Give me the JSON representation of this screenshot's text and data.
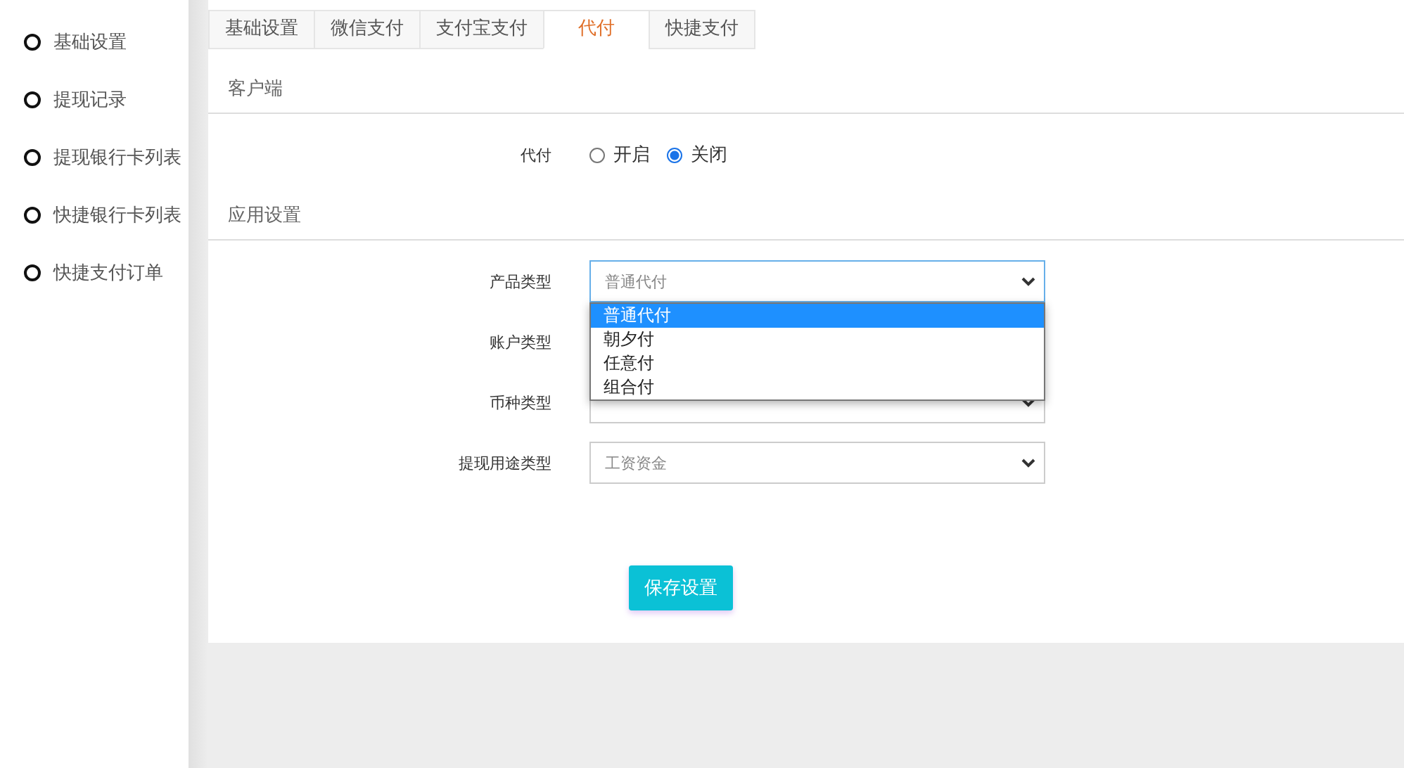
{
  "sidebar": {
    "items": [
      {
        "label": "基础设置"
      },
      {
        "label": "提现记录"
      },
      {
        "label": "提现银行卡列表"
      },
      {
        "label": "快捷银行卡列表"
      },
      {
        "label": "快捷支付订单"
      }
    ]
  },
  "tabs": [
    {
      "label": "基础设置",
      "selected": false
    },
    {
      "label": "微信支付",
      "selected": false
    },
    {
      "label": "支付宝支付",
      "selected": false
    },
    {
      "label": "代付",
      "selected": true
    },
    {
      "label": "快捷支付",
      "selected": false
    }
  ],
  "sections": [
    {
      "title": "客户端",
      "fields": [
        {
          "kind": "radio",
          "label": "代付",
          "options": [
            {
              "label": "开启",
              "selected": false
            },
            {
              "label": "关闭",
              "selected": true
            }
          ]
        }
      ]
    },
    {
      "title": "应用设置",
      "fields": [
        {
          "kind": "select",
          "label": "产品类型",
          "value": "普通代付",
          "focused": true
        },
        {
          "kind": "covered",
          "label": "账户类型"
        },
        {
          "kind": "select",
          "label": "币种类型"
        },
        {
          "kind": "select",
          "label": "提现用途类型",
          "value": "工资资金"
        }
      ]
    }
  ],
  "dropdown": {
    "options": [
      {
        "label": "普通代付",
        "selected": true
      },
      {
        "label": "朝夕付",
        "selected": false
      },
      {
        "label": "任意付",
        "selected": false
      },
      {
        "label": "组合付",
        "selected": false
      }
    ]
  },
  "save_button": "保存设置"
}
